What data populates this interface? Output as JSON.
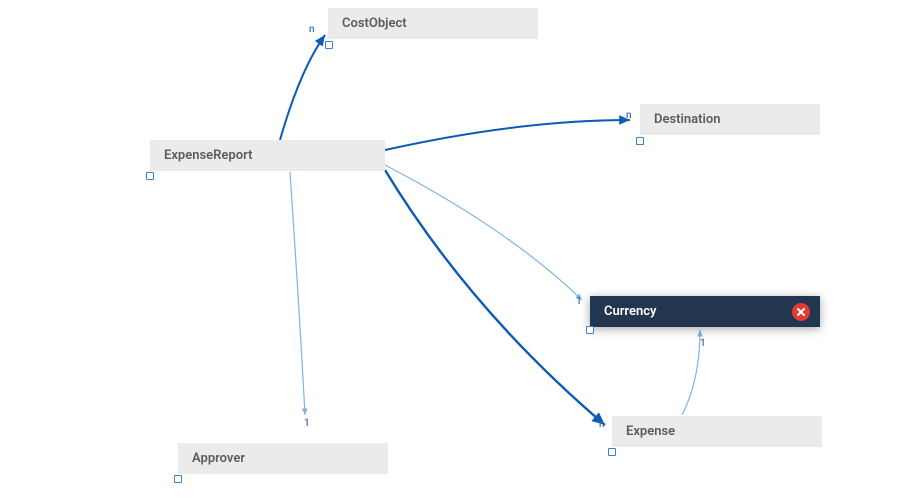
{
  "nodes": {
    "expenseReport": {
      "label": "ExpenseReport",
      "selected": false
    },
    "costObject": {
      "label": "CostObject",
      "selected": false
    },
    "destination": {
      "label": "Destination",
      "selected": false
    },
    "currency": {
      "label": "Currency",
      "selected": true
    },
    "expense": {
      "label": "Expense",
      "selected": false
    },
    "approver": {
      "label": "Approver",
      "selected": false
    }
  },
  "cardinality": {
    "expenseReport_costObject": "n",
    "expenseReport_destination": "n",
    "expenseReport_currency": "1",
    "expenseReport_expense": "n",
    "expenseReport_approver": "1",
    "expense_currency": "1"
  },
  "colors": {
    "edge_strong": "#0d5bb5",
    "edge_light": "#7fb2e5",
    "node_bg": "#ebebeb",
    "node_fg": "#5c5c5c",
    "selected_bg": "#22374f",
    "selected_fg": "#ffffff",
    "close_btn": "#e53935"
  }
}
